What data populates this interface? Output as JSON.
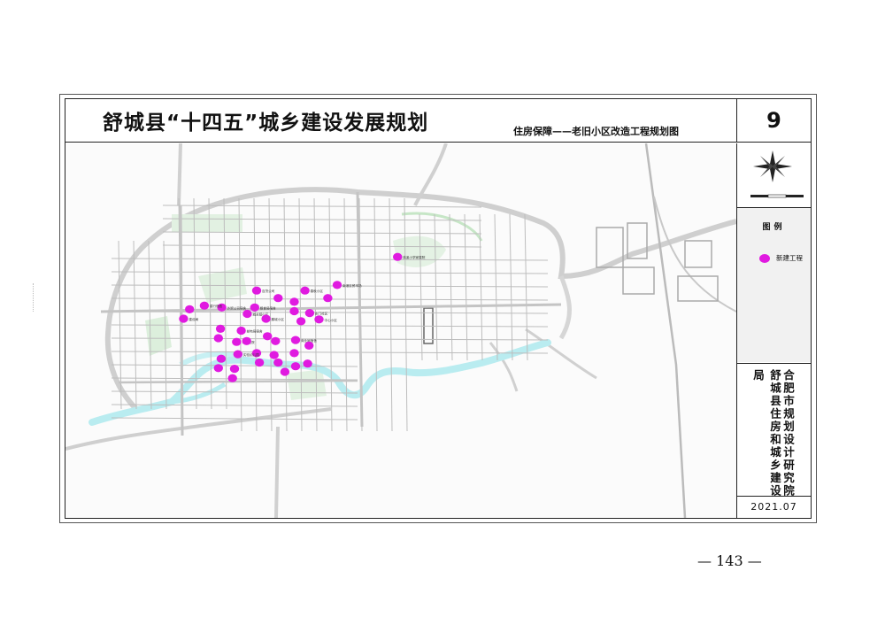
{
  "header": {
    "title": "舒城县“十四五”城乡建设发展规划",
    "subtitle": "住房保障——老旧小区改造工程规划图",
    "sheet_number": "9"
  },
  "legend": {
    "title": "图例",
    "items": [
      {
        "label": "新建工程",
        "color": "#e01ae0"
      }
    ]
  },
  "organizations": {
    "designer": "合肥市规划设计研究院",
    "client": "舒城县住房和城乡建设局"
  },
  "date": "2021.07",
  "page_number": "— 143 —",
  "colors": {
    "marker": "#e01ae0",
    "water": "#b9ecf0",
    "green": "#d8eed8",
    "road": "#bdbdbd"
  },
  "map": {
    "markers": [
      {
        "x": 0.495,
        "y": 0.303,
        "label": "桃溪小学家属院"
      },
      {
        "x": 0.405,
        "y": 0.378,
        "label": "南港农贸市场"
      },
      {
        "x": 0.357,
        "y": 0.393,
        "label": "春秋小区"
      },
      {
        "x": 0.317,
        "y": 0.413,
        "label": ""
      },
      {
        "x": 0.285,
        "y": 0.393,
        "label": "百货公司"
      },
      {
        "x": 0.282,
        "y": 0.438,
        "label": "粮食局宿舍"
      },
      {
        "x": 0.271,
        "y": 0.455,
        "label": "城关镇小区"
      },
      {
        "x": 0.233,
        "y": 0.438,
        "label": "外贸公司宿舍"
      },
      {
        "x": 0.207,
        "y": 0.433,
        "label": "建行宿舍"
      },
      {
        "x": 0.185,
        "y": 0.443,
        "label": ""
      },
      {
        "x": 0.176,
        "y": 0.468,
        "label": "建设局"
      },
      {
        "x": 0.299,
        "y": 0.468,
        "label": "鹏城小区"
      },
      {
        "x": 0.341,
        "y": 0.423,
        "label": ""
      },
      {
        "x": 0.341,
        "y": 0.448,
        "label": ""
      },
      {
        "x": 0.364,
        "y": 0.453,
        "label": "东门社区"
      },
      {
        "x": 0.391,
        "y": 0.413,
        "label": ""
      },
      {
        "x": 0.378,
        "y": 0.47,
        "label": "中心小区"
      },
      {
        "x": 0.351,
        "y": 0.475,
        "label": ""
      },
      {
        "x": 0.262,
        "y": 0.5,
        "label": "邮电局宿舍"
      },
      {
        "x": 0.231,
        "y": 0.495,
        "label": ""
      },
      {
        "x": 0.228,
        "y": 0.52,
        "label": ""
      },
      {
        "x": 0.255,
        "y": 0.53,
        "label": "人民医院"
      },
      {
        "x": 0.27,
        "y": 0.528,
        "label": ""
      },
      {
        "x": 0.301,
        "y": 0.515,
        "label": ""
      },
      {
        "x": 0.313,
        "y": 0.528,
        "label": ""
      },
      {
        "x": 0.343,
        "y": 0.525,
        "label": "商业局宿舍"
      },
      {
        "x": 0.363,
        "y": 0.54,
        "label": ""
      },
      {
        "x": 0.341,
        "y": 0.56,
        "label": ""
      },
      {
        "x": 0.311,
        "y": 0.565,
        "label": ""
      },
      {
        "x": 0.285,
        "y": 0.56,
        "label": ""
      },
      {
        "x": 0.257,
        "y": 0.563,
        "label": "实验幼儿园"
      },
      {
        "x": 0.232,
        "y": 0.575,
        "label": ""
      },
      {
        "x": 0.252,
        "y": 0.602,
        "label": ""
      },
      {
        "x": 0.289,
        "y": 0.585,
        "label": ""
      },
      {
        "x": 0.317,
        "y": 0.585,
        "label": ""
      },
      {
        "x": 0.343,
        "y": 0.595,
        "label": ""
      },
      {
        "x": 0.361,
        "y": 0.588,
        "label": ""
      },
      {
        "x": 0.327,
        "y": 0.61,
        "label": ""
      },
      {
        "x": 0.249,
        "y": 0.627,
        "label": ""
      },
      {
        "x": 0.228,
        "y": 0.6,
        "label": ""
      }
    ]
  }
}
